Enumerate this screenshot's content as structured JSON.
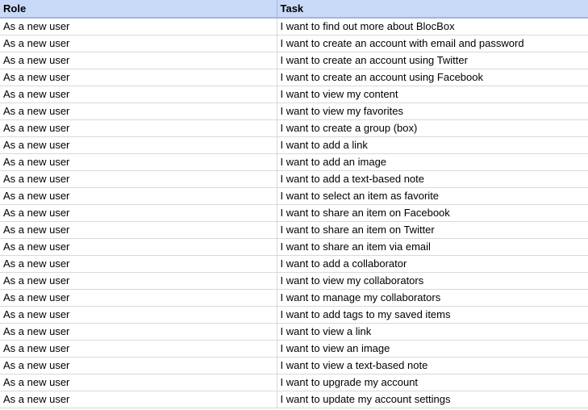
{
  "table": {
    "headers": [
      "Role",
      "Task"
    ],
    "rows": [
      [
        "As a new user",
        "I want to find out more about BlocBox"
      ],
      [
        "As a new user",
        "I want to create an account with email and password"
      ],
      [
        "As a new user",
        "I want to create an account using Twitter"
      ],
      [
        "As a new user",
        "I want to create an account using Facebook"
      ],
      [
        "As a new user",
        "I want to view my content"
      ],
      [
        "As a new user",
        "I want to view my favorites"
      ],
      [
        "As a new user",
        "I want to create a group (box)"
      ],
      [
        "As a new user",
        "I want to add a link"
      ],
      [
        "As a new user",
        "I want to add an image"
      ],
      [
        "As a new user",
        "I want to add a text-based note"
      ],
      [
        "As a new user",
        "I want to select an item as favorite"
      ],
      [
        "As a new user",
        "I want to share an item on Facebook"
      ],
      [
        "As a new user",
        "I want to share an item on Twitter"
      ],
      [
        "As a new user",
        "I want to share an item via email"
      ],
      [
        "As a new user",
        "I want to add a collaborator"
      ],
      [
        "As a new user",
        "I want to view my collaborators"
      ],
      [
        "As a new user",
        "I want to manage my collaborators"
      ],
      [
        "As a new user",
        "I want to add tags to my saved items"
      ],
      [
        "As a new user",
        "I want to view a link"
      ],
      [
        "As a new user",
        "I want to view an image"
      ],
      [
        "As a new user",
        "I want to view a text-based note"
      ],
      [
        "As a new user",
        "I want to upgrade my account"
      ],
      [
        "As a new user",
        "I want to update my account settings"
      ]
    ]
  },
  "colors": {
    "header_bg": "#c9daf8",
    "grid": "#d9d9d9"
  }
}
